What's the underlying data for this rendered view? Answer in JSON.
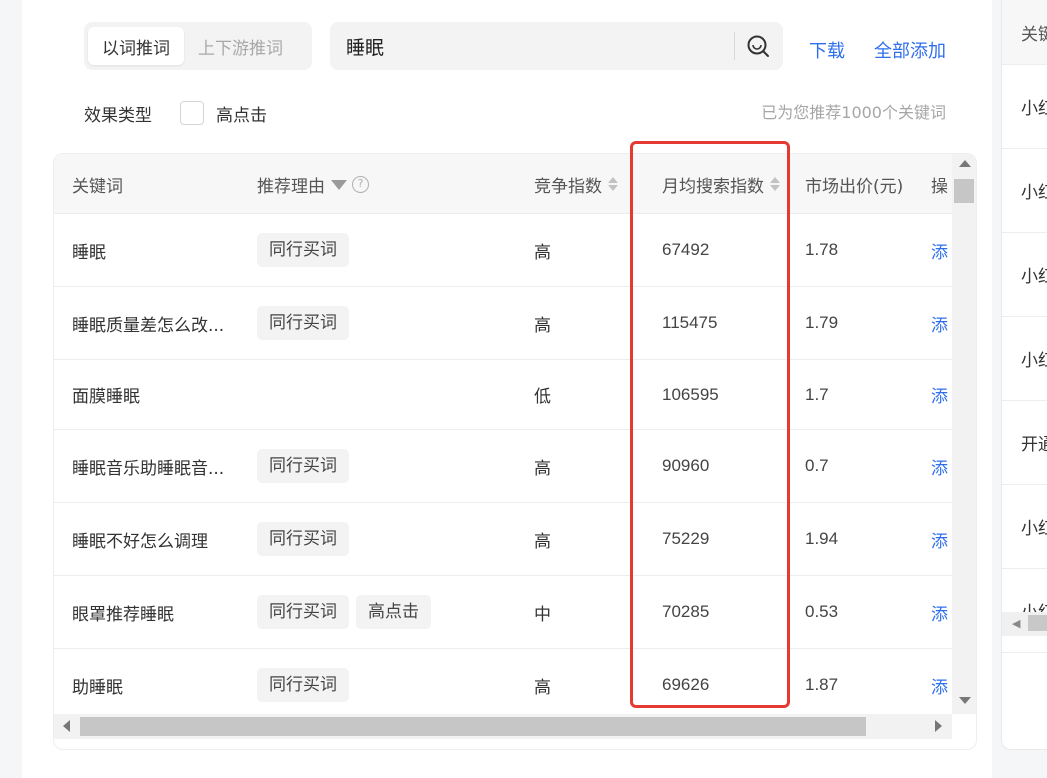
{
  "tabs": [
    {
      "label": "以词推词",
      "active": true
    },
    {
      "label": "上下游推词",
      "active": false
    }
  ],
  "search": {
    "value": "睡眠",
    "icon": "search-icon"
  },
  "actions": {
    "download": "下载",
    "add_all": "全部添加"
  },
  "filter": {
    "effect_type_label": "效果类型",
    "high_click_label": "高点击",
    "high_click_checked": false
  },
  "recommend_note": "已为您推荐1000个关键词",
  "table": {
    "headers": {
      "keyword": "关键词",
      "reason": "推荐理由",
      "competition": "竞争指数",
      "monthly_search": "月均搜索指数",
      "market_bid": "市场出价(元)",
      "operation": "操"
    },
    "rows": [
      {
        "keyword": "睡眠",
        "tags": [
          "同行买词"
        ],
        "competition": "高",
        "monthly_search": "67492",
        "market_bid": "1.78",
        "op": "添"
      },
      {
        "keyword": "睡眠质量差怎么改...",
        "tags": [
          "同行买词"
        ],
        "competition": "高",
        "monthly_search": "115475",
        "market_bid": "1.79",
        "op": "添"
      },
      {
        "keyword": "面膜睡眠",
        "tags": [],
        "competition": "低",
        "monthly_search": "106595",
        "market_bid": "1.7",
        "op": "添"
      },
      {
        "keyword": "睡眠音乐助睡眠音...",
        "tags": [
          "同行买词"
        ],
        "competition": "高",
        "monthly_search": "90960",
        "market_bid": "0.7",
        "op": "添"
      },
      {
        "keyword": "睡眠不好怎么调理",
        "tags": [
          "同行买词"
        ],
        "competition": "高",
        "monthly_search": "75229",
        "market_bid": "1.94",
        "op": "添"
      },
      {
        "keyword": "眼罩推荐睡眠",
        "tags": [
          "同行买词",
          "高点击"
        ],
        "competition": "中",
        "monthly_search": "70285",
        "market_bid": "0.53",
        "op": "添"
      },
      {
        "keyword": "助睡眠",
        "tags": [
          "同行买词"
        ],
        "competition": "高",
        "monthly_search": "69626",
        "market_bid": "1.87",
        "op": "添"
      }
    ]
  },
  "right_panel": {
    "header": "关键",
    "items": [
      "小红",
      "小红",
      "小红",
      "小红",
      "开通",
      "小红",
      "小红"
    ]
  },
  "colors": {
    "accent": "#2f6fed",
    "highlight": "#e53a32"
  }
}
